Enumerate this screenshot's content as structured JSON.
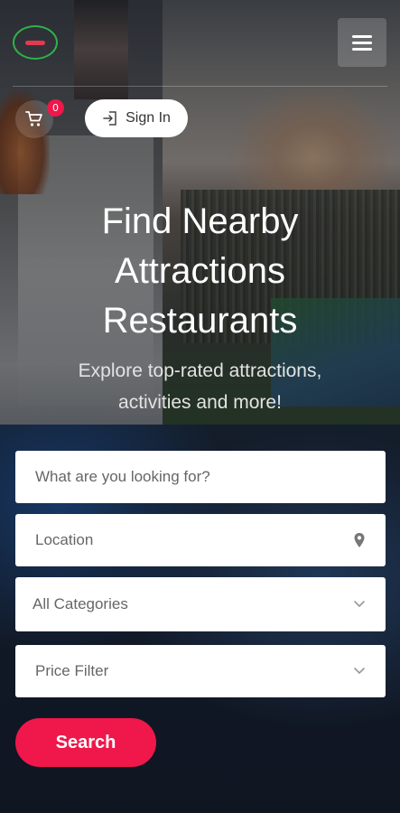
{
  "header": {
    "logo_icon": "logo-icon",
    "menu_icon": "hamburger-menu-icon",
    "cart": {
      "icon": "shopping-cart-icon",
      "count": "0"
    },
    "signin": {
      "icon": "sign-in-icon",
      "label": "Sign In"
    }
  },
  "hero": {
    "title_lines": [
      "Find Nearby",
      "Attractions",
      "Restaurants"
    ],
    "subtitle_lines": [
      "Explore top-rated attractions,",
      "activities and more!"
    ]
  },
  "form": {
    "search_placeholder": "What are you looking for?",
    "location_placeholder": "Location",
    "location_icon": "map-pin-icon",
    "category_selected": "All Categories",
    "price_selected": "Price Filter",
    "dropdown_icon": "chevron-down-icon",
    "search_button": "Search"
  },
  "colors": {
    "accent": "#f0174a",
    "logo_ring": "#2fb24a"
  }
}
